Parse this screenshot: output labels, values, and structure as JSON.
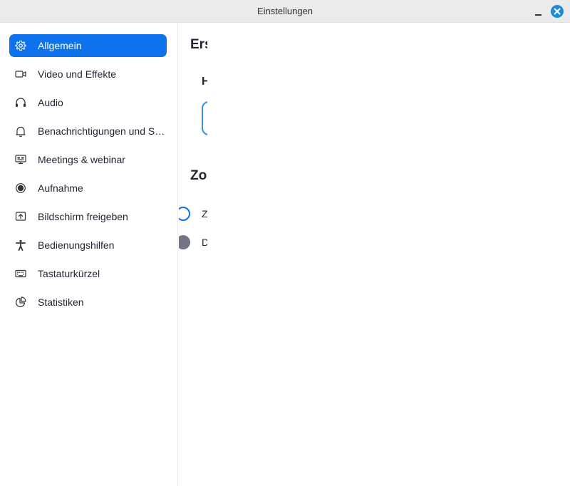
{
  "window": {
    "title": "Einstellungen"
  },
  "sidebar": {
    "items": [
      {
        "label": "Allgemein",
        "icon": "gear-icon",
        "active": true
      },
      {
        "label": "Video und Effekte",
        "icon": "video-camera-icon",
        "active": false
      },
      {
        "label": "Audio",
        "icon": "headphones-icon",
        "active": false
      },
      {
        "label": "Benachrichtigungen und Sounds",
        "icon": "bell-icon",
        "active": false
      },
      {
        "label": "Meetings & webinar",
        "icon": "meetings-icon",
        "active": false
      },
      {
        "label": "Aufnahme",
        "icon": "record-icon",
        "active": false
      },
      {
        "label": "Bildschirm freigeben",
        "icon": "share-screen-icon",
        "active": false
      },
      {
        "label": "Bedienungshilfen",
        "icon": "accessibility-icon",
        "active": false
      },
      {
        "label": "Tastaturkürzel",
        "icon": "keyboard-icon",
        "active": false
      },
      {
        "label": "Statistiken",
        "icon": "pie-chart-icon",
        "active": false
      }
    ]
  },
  "main": {
    "section1_heading": "Ers",
    "section1_subheading": "H",
    "section2_heading": "Zo",
    "option1_label": "Z",
    "option2_label": "D"
  },
  "colors": {
    "accent": "#0e72ed",
    "close_button": "#1d8bd8",
    "titlebar": "#ebebeb",
    "text": "#232333"
  }
}
